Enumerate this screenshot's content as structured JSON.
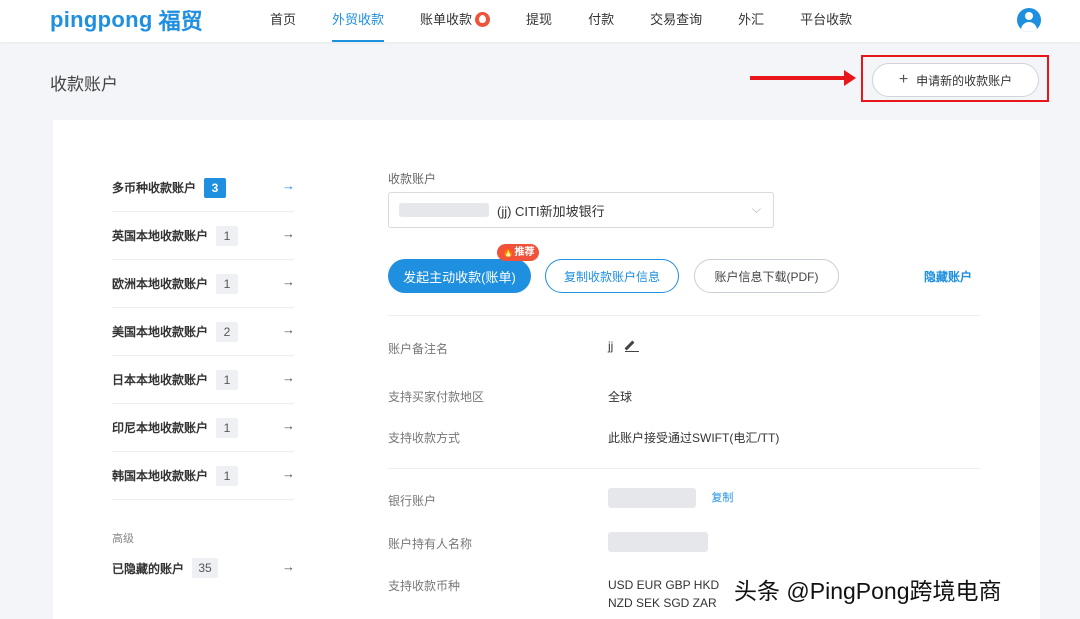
{
  "brand": {
    "name_en": "pingpong",
    "name_cn": "福贸"
  },
  "nav": [
    {
      "label": "首页",
      "active": false
    },
    {
      "label": "外贸收款",
      "active": true
    },
    {
      "label": "账单收款",
      "active": false,
      "badge": "fire-icon"
    },
    {
      "label": "提现",
      "active": false
    },
    {
      "label": "付款",
      "active": false
    },
    {
      "label": "交易查询",
      "active": false
    },
    {
      "label": "外汇",
      "active": false
    },
    {
      "label": "平台收款",
      "active": false
    }
  ],
  "page": {
    "title": "收款账户",
    "apply_button": "申请新的收款账户"
  },
  "accounts": [
    {
      "label": "多币种收款账户",
      "count": "3",
      "active": true
    },
    {
      "label": "英国本地收款账户",
      "count": "1"
    },
    {
      "label": "欧洲本地收款账户",
      "count": "1"
    },
    {
      "label": "美国本地收款账户",
      "count": "2"
    },
    {
      "label": "日本本地收款账户",
      "count": "1"
    },
    {
      "label": "印尼本地收款账户",
      "count": "1"
    },
    {
      "label": "韩国本地收款账户",
      "count": "1"
    }
  ],
  "advanced": {
    "label": "高级",
    "hidden_label": "已隐藏的账户",
    "hidden_count": "35"
  },
  "detail": {
    "select_label": "收款账户",
    "select_value": "(jj)  CITI新加坡银行",
    "btn_primary": "发起主动收款(账单)",
    "badge": "推荐",
    "btn_copy": "复制收款账户信息",
    "btn_download": "账户信息下载(PDF)",
    "hide": "隐藏账户",
    "note_label": "账户备注名",
    "note_value": "jj",
    "region_label": "支持买家付款地区",
    "region_value": "全球",
    "method_label": "支持收款方式",
    "method_value": "此账户接受通过SWIFT(电汇/TT)",
    "bank_label": "银行账户",
    "bank_copy": "复制",
    "holder_label": "账户持有人名称",
    "currency_label": "支持收款币种",
    "currency_line1": "USD EUR GBP HKD",
    "currency_line2": "NZD SEK SGD ZAR"
  },
  "watermark": "头条 @PingPong跨境电商",
  "colors": {
    "accent": "#1f8fe0",
    "annotation": "#e8161b",
    "badge": "#f0533a"
  }
}
